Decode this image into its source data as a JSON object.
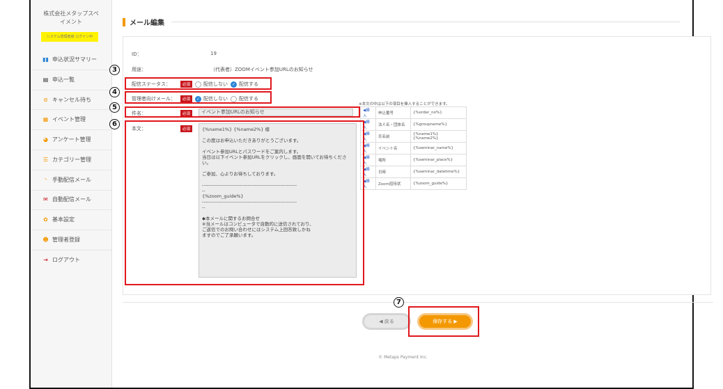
{
  "sidebar": {
    "brand_line1": "株式会社メタップスペ",
    "brand_line2": "イメント",
    "login_badge": "システム管理者様 ログイン中",
    "items": [
      {
        "icon": "chart-icon",
        "glyph": "▮▮",
        "label": "申込状況サマリー"
      },
      {
        "icon": "book-icon",
        "glyph": "▤",
        "label": "申込一覧"
      },
      {
        "icon": "cancel-icon",
        "glyph": "⊘",
        "label": "キャンセル待ち"
      },
      {
        "icon": "grid-icon",
        "glyph": "▦",
        "label": "イベント管理"
      },
      {
        "icon": "pie-icon",
        "glyph": "◕",
        "label": "アンケート管理"
      },
      {
        "icon": "list-icon",
        "glyph": "☰",
        "label": "カテゴリー管理"
      },
      {
        "icon": "rss-icon",
        "glyph": "◝",
        "label": "手動配信メール"
      },
      {
        "icon": "mail-icon",
        "glyph": "✉",
        "label": "自動配信メール"
      },
      {
        "icon": "gear-icon",
        "glyph": "✿",
        "label": "基本設定"
      },
      {
        "icon": "users-icon",
        "glyph": "☻",
        "label": "管理者登録"
      },
      {
        "icon": "logout-icon",
        "glyph": "⇥",
        "label": "ログアウト"
      }
    ]
  },
  "page": {
    "title": "メール編集"
  },
  "form": {
    "id_label": "ID：",
    "id_value": "19",
    "purpose_label": "用途：",
    "purpose_value": "（代表者）ZOOMイベント参加URLのお知らせ",
    "required": "必須",
    "status_label": "配信ステータス：",
    "status_off": "配信しない",
    "status_on": "配信する",
    "admin_label": "管理者向けメール：",
    "admin_off": "配信しない",
    "admin_on": "配信する",
    "subject_label": "件名：",
    "subject_value": "イベント参加URLのお知らせ",
    "body_label": "本文：",
    "body_value": "{%name1%} {%name2%} 様\n\nこの度はお申込いただきありがとうございます。\n\nイベント参加URLとパスワードをご案内します。\n当日は以下イベント参加URLをクリックし、画面を開いてお待ちください。\n\nご参加、心よりお待ちしております。\n\n----------------------------------------------------------\n--\n{%zoom_guide%}\n----------------------------------------------------------\n--\n\n◆本メールに関するお問合せ\n※当メールはコンピュータで自動的に送信されており、\nご返信でのお問い合わせにはシステム上回答致しかね\nますのでご了承願います。"
  },
  "placeholders": {
    "note": "※本文の中は以下の項目を挿入することができます。",
    "insert_label": "挿入",
    "rows": [
      {
        "name": "申込番号",
        "code": "{%order_no%}"
      },
      {
        "name": "法人名・団体名",
        "code": "{%groupname%}"
      },
      {
        "name": "氏名前",
        "code": "{%name1%} {%name2%}"
      },
      {
        "name": "イベント名",
        "code": "{%seminar_name%}"
      },
      {
        "name": "場所",
        "code": "{%seminar_place%}"
      },
      {
        "name": "日時",
        "code": "{%seminar_datetime%}"
      },
      {
        "name": "Zoom招待状",
        "code": "{%zoom_guide%}"
      }
    ]
  },
  "annotations": {
    "n3": "3",
    "n4": "4",
    "n5": "5",
    "n6": "6",
    "n7": "7"
  },
  "buttons": {
    "back": "戻る",
    "save": "保存する"
  },
  "footer": {
    "copyright": "© Metaps Payment Inc."
  },
  "colors": {
    "accent": "#f39800",
    "required": "#c9161d",
    "annotation": "#e0161b",
    "radio_on": "#2a84d6"
  }
}
